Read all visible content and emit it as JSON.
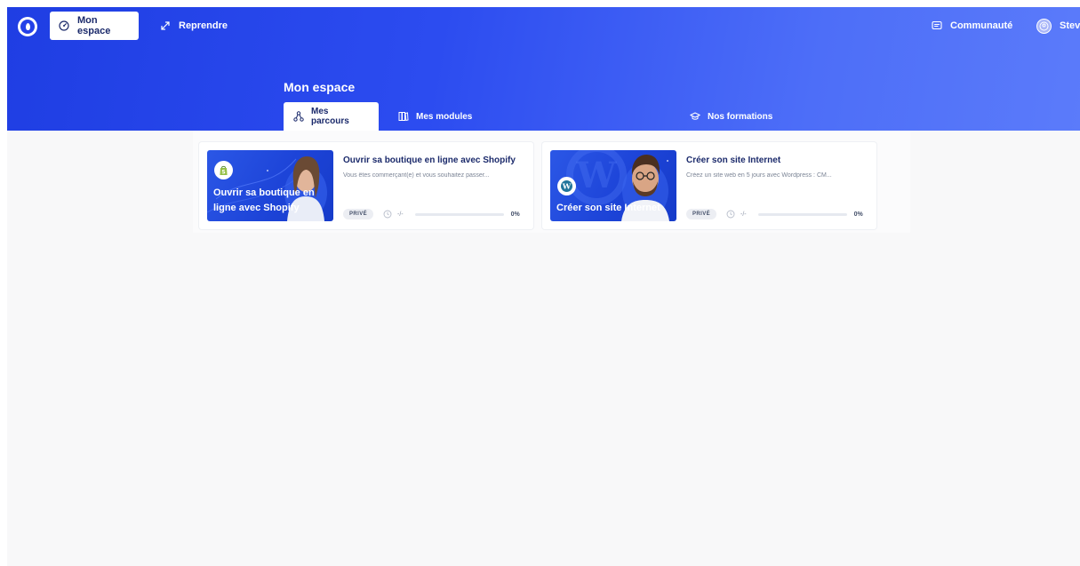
{
  "brand": {
    "accent": "#2c4cf0",
    "hero_gradient": [
      "#1f3ee3",
      "#5b7bfa"
    ],
    "text_dark": "#1b2a6b"
  },
  "topnav": {
    "logo_icon": "drop-circle-icon",
    "items": [
      {
        "label": "Mon espace",
        "icon": "gauge-icon",
        "active": true
      },
      {
        "label": "Reprendre",
        "icon": "arrows-diagonal-icon",
        "active": false
      }
    ],
    "community_label": "Communauté",
    "community_icon": "message-icon",
    "user_name": "Steve"
  },
  "page": {
    "title": "Mon espace",
    "tabs": [
      {
        "label": "Mes parcours",
        "icon": "network-icon",
        "active": true
      },
      {
        "label": "Mes modules",
        "icon": "books-icon",
        "active": false
      },
      {
        "label": "Nos formations",
        "icon": "graduation-cap-icon",
        "active": false
      }
    ]
  },
  "cards": [
    {
      "thumb_title": "Ouvrir sa boutique en ligne avec Shopify",
      "thumb_logo": "shopify-bag-icon",
      "title": "Ouvrir sa boutique en ligne avec Shopify",
      "description": "Vous êtes commerçant(e) et vous souhaitez passer...",
      "visibility": "PRIVÉ",
      "time": "-/-",
      "progress": 0,
      "progress_label": "0%"
    },
    {
      "thumb_title": "Créer son site Internet",
      "thumb_logo": "wordpress-icon",
      "title": "Créer son site Internet",
      "description": "Créez un site web en 5 jours avec Wordpress : CM...",
      "visibility": "PRIVÉ",
      "time": "-/-",
      "progress": 0,
      "progress_label": "0%"
    }
  ]
}
